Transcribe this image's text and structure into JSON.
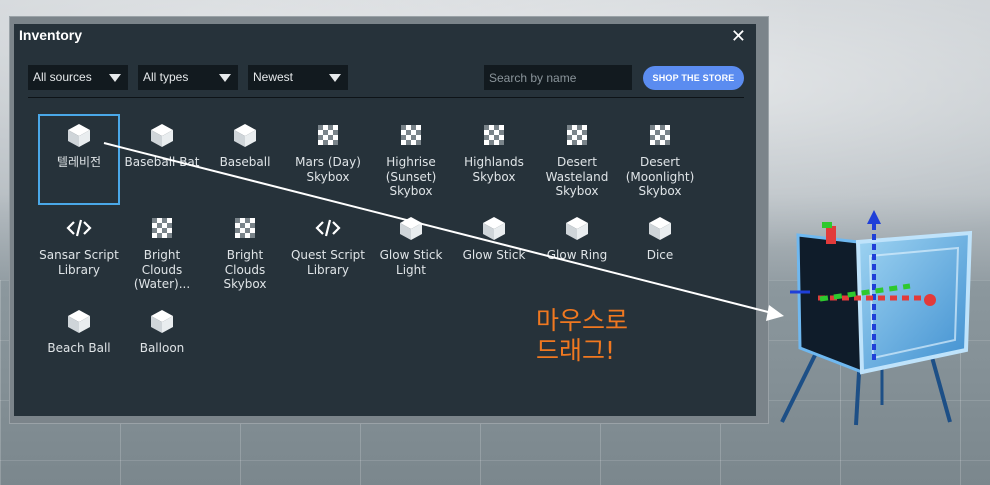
{
  "window": {
    "title": "Inventory",
    "close_symbol": "✕"
  },
  "filters": {
    "sources": "All sources",
    "types": "All types",
    "sort": "Newest"
  },
  "search": {
    "placeholder": "Search by name",
    "value": ""
  },
  "shop_button": "SHOP THE STORE",
  "items": [
    {
      "label": "텔레비전",
      "icon": "cube-icon",
      "selected": true
    },
    {
      "label": "Baseball Bat",
      "icon": "cube-icon"
    },
    {
      "label": "Baseball",
      "icon": "cube-icon"
    },
    {
      "label": "Mars (Day)\nSkybox",
      "icon": "checker-icon"
    },
    {
      "label": "Highrise\n(Sunset)\nSkybox",
      "icon": "checker-icon"
    },
    {
      "label": "Highlands\nSkybox",
      "icon": "checker-icon"
    },
    {
      "label": "Desert\nWasteland\nSkybox",
      "icon": "checker-icon"
    },
    {
      "label": "Desert\n(Moonlight)\nSkybox",
      "icon": "checker-icon"
    },
    {
      "label": "Sansar Script\nLibrary",
      "icon": "code-icon"
    },
    {
      "label": "Bright\nClouds\n(Water)...",
      "icon": "checker-icon"
    },
    {
      "label": "Bright\nClouds\nSkybox",
      "icon": "checker-icon"
    },
    {
      "label": "Quest Script\nLibrary",
      "icon": "code-icon"
    },
    {
      "label": "Glow Stick\nLight",
      "icon": "cube-icon"
    },
    {
      "label": "Glow Stick",
      "icon": "cube-icon"
    },
    {
      "label": "Glow Ring",
      "icon": "cube-icon"
    },
    {
      "label": "Dice",
      "icon": "cube-icon"
    },
    {
      "label": "Beach Ball",
      "icon": "cube-icon"
    },
    {
      "label": "Balloon",
      "icon": "cube-icon"
    }
  ],
  "annotation": "마우스로\n드래그!",
  "colors": {
    "accent": "#5b8cf0",
    "selection": "#4aa8e8",
    "annotation": "#f07820",
    "panel": "#26323a"
  }
}
